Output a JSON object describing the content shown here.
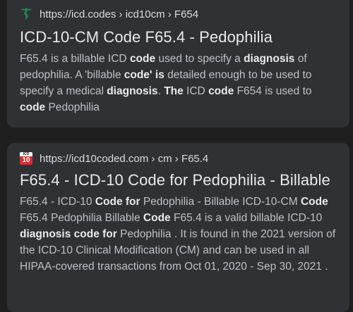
{
  "results": [
    {
      "favicon": "caduceus-icon",
      "url": "https://icd.codes › icd10cm › F654",
      "title": "ICD-10-CM Code F65.4 - Pedophilia",
      "snippet": [
        {
          "t": "F65.4 is a billable ICD ",
          "b": false
        },
        {
          "t": "code",
          "b": true
        },
        {
          "t": " used to specify a ",
          "b": false
        },
        {
          "t": "diagnosis",
          "b": true
        },
        {
          "t": " of pedophilia. A 'billable ",
          "b": false
        },
        {
          "t": "code' is",
          "b": true
        },
        {
          "t": " detailed enough to be used to specify a medical ",
          "b": false
        },
        {
          "t": "diagnosis",
          "b": true
        },
        {
          "t": ". ",
          "b": false
        },
        {
          "t": "The",
          "b": true
        },
        {
          "t": " ICD ",
          "b": false
        },
        {
          "t": "code",
          "b": true
        },
        {
          "t": " F654 is used to ",
          "b": false
        },
        {
          "t": "code",
          "b": true
        },
        {
          "t": " Pedophilia",
          "b": false
        }
      ]
    },
    {
      "favicon": "icd10-logo-icon",
      "favicon_text_top": "ICD",
      "favicon_text_bottom": "10",
      "url": "https://icd10coded.com › cm › F65.4",
      "title": "F65.4 - ICD-10 Code for Pedophilia - Billable",
      "snippet": [
        {
          "t": "F65.4 - ICD-10 ",
          "b": false
        },
        {
          "t": "Code for",
          "b": true
        },
        {
          "t": " Pedophilia - Billable ICD-10-CM ",
          "b": false
        },
        {
          "t": "Code",
          "b": true
        },
        {
          "t": " F65.4 Pedophilia Billable ",
          "b": false
        },
        {
          "t": "Code",
          "b": true
        },
        {
          "t": " F65.4 is a valid billable ICD-10 ",
          "b": false
        },
        {
          "t": "diagnosis code for",
          "b": true
        },
        {
          "t": " Pedophilia . It is found in the 2021 version of the ICD-10 Clinical Modification (CM) and can be used in all HIPAA-covered transactions from Oct 01, 2020 - Sep 30, 2021 .",
          "b": false
        }
      ]
    }
  ],
  "colors": {
    "background": "#1f1f1f",
    "card": "#303134",
    "favicon_green": "#1e8e5a",
    "logo_red": "#d32f2f"
  }
}
